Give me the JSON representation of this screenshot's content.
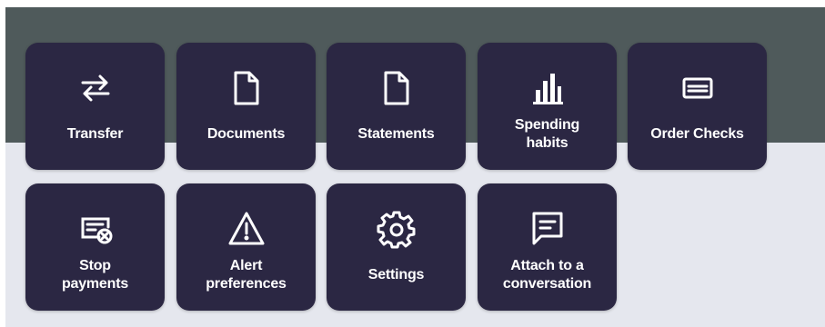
{
  "tiles_row1": [
    {
      "label": "Transfer",
      "icon": "transfer-arrows-icon"
    },
    {
      "label": "Documents",
      "icon": "document-icon"
    },
    {
      "label": "Statements",
      "icon": "document-icon"
    },
    {
      "label": "Spending\nhabits",
      "icon": "bar-chart-icon"
    },
    {
      "label": "Order Checks",
      "icon": "check-icon"
    }
  ],
  "tiles_row2": [
    {
      "label": "Stop\npayments",
      "icon": "stop-payment-icon"
    },
    {
      "label": "Alert\npreferences",
      "icon": "warning-triangle-icon"
    },
    {
      "label": "Settings",
      "icon": "gear-icon"
    },
    {
      "label": "Attach to a\nconversation",
      "icon": "chat-bubble-icon"
    }
  ],
  "colors": {
    "tile_background": "#2b2743",
    "header_band": "#4f5a5b",
    "page_background": "#e5e7ee",
    "text": "#ffffff"
  }
}
